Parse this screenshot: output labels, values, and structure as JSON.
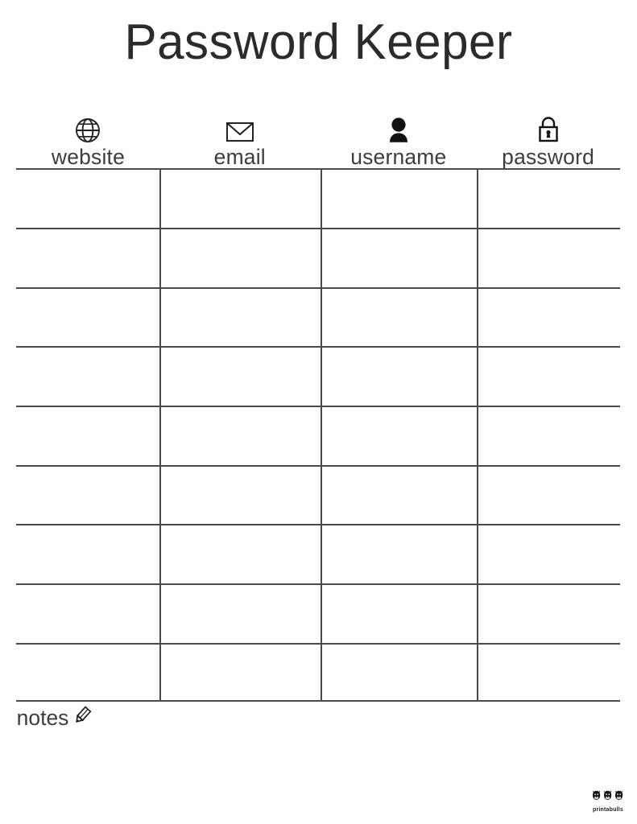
{
  "document": {
    "title": "Password Keeper",
    "type": "printable-worksheet",
    "page_background": "#ffffff",
    "line_color": "#4a4a4a",
    "text_color": "#3d3d3d"
  },
  "table": {
    "columns": [
      {
        "label": "website",
        "icon": "globe-icon"
      },
      {
        "label": "email",
        "icon": "envelope-icon"
      },
      {
        "label": "username",
        "icon": "person-icon"
      },
      {
        "label": "password",
        "icon": "lock-icon"
      }
    ],
    "row_count": 9,
    "rows": [
      {
        "website": "",
        "email": "",
        "username": "",
        "password": ""
      },
      {
        "website": "",
        "email": "",
        "username": "",
        "password": ""
      },
      {
        "website": "",
        "email": "",
        "username": "",
        "password": ""
      },
      {
        "website": "",
        "email": "",
        "username": "",
        "password": ""
      },
      {
        "website": "",
        "email": "",
        "username": "",
        "password": ""
      },
      {
        "website": "",
        "email": "",
        "username": "",
        "password": ""
      },
      {
        "website": "",
        "email": "",
        "username": "",
        "password": ""
      },
      {
        "website": "",
        "email": "",
        "username": "",
        "password": ""
      },
      {
        "website": "",
        "email": "",
        "username": "",
        "password": ""
      }
    ]
  },
  "notes": {
    "label": "notes",
    "icon": "pencil-icon",
    "value": ""
  },
  "brand": {
    "name": "printabulls",
    "logo": "three-bulldog-faces-icon"
  }
}
